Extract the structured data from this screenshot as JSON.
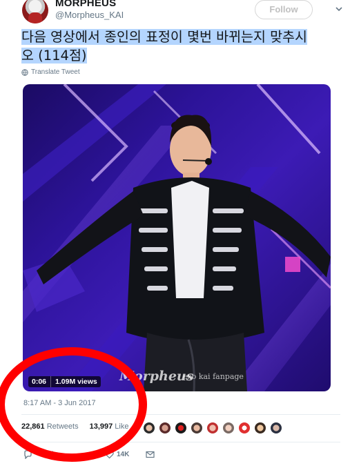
{
  "user": {
    "display_name": "MORPHEUS",
    "handle": "@Morpheus_KAI",
    "follow_label": "Follow"
  },
  "tweet": {
    "text_line1": "다음 영상에서 종인의 표정이 몇번 바뀌는지 맞추시",
    "text_line2": "오 (114점)",
    "translate_label": "Translate Tweet",
    "timestamp": "8:17 AM - 3 Jun 2017"
  },
  "media": {
    "duration": "0:06",
    "views": "1.09M views",
    "watermark_brand": "Morpheus",
    "watermark_text": "exo kai fanpage"
  },
  "stats": {
    "retweets_count": "22,861",
    "retweets_label": "Retweets",
    "likes_count": "13,997",
    "likes_label": "Like"
  },
  "actions": {
    "like_count": "14K"
  },
  "colors": {
    "annotation_circle": "#ff0000",
    "text_highlight": "#b4d5fe",
    "muted_text": "#657786"
  },
  "icons": {
    "header_menu": "chevron-down-icon",
    "translate": "globe-icon",
    "reply": "reply-icon",
    "retweet": "retweet-icon",
    "like": "heart-icon",
    "dm": "envelope-icon"
  }
}
